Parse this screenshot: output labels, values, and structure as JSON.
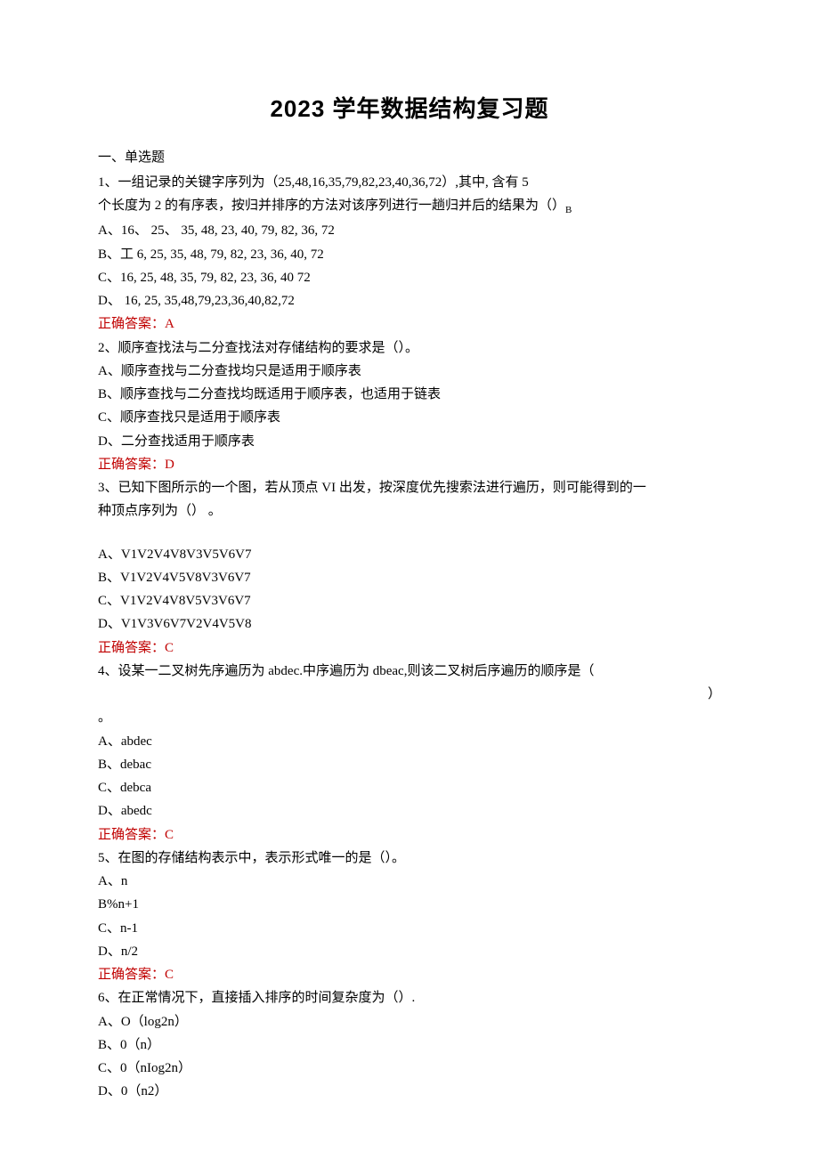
{
  "title": "2023 学年数据结构复习题",
  "section1": "一、单选题",
  "q1": {
    "stem_a": "1、一组记录的关键字序列为（25,48,16,35,79,82,23,40,36,72）,其中, 含有 5",
    "stem_b": "个长度为 2 的有序表，按归并排序的方法对该序列进行一趟归并后的结果为（）",
    "stem_sub": "B",
    "A": "A、16、 25、 35, 48, 23, 40, 79, 82, 36, 72",
    "B": "B、工 6, 25, 35, 48,        79, 82, 23, 36, 40, 72",
    "C": "C、16,    25, 48, 35, 79, 82, 23, 36, 40                         72",
    "D": "D、 16, 25, 35,48,79,23,36,40,82,72",
    "ans": "正确答案：A"
  },
  "q2": {
    "stem": "2、顺序查找法与二分查找法对存储结构的要求是（）。",
    "A": "A、顺序查找与二分查找均只是适用于顺序表",
    "B": "B、顺序查找与二分查找均既适用于顺序表，也适用于链表",
    "C": "C、顺序查找只是适用于顺序表",
    "D": "D、二分查找适用于顺序表",
    "ans": "正确答案：D"
  },
  "q3": {
    "stem_a": "3、已知下图所示的一个图，若从顶点 VI 出发，按深度优先搜索法进行遍历，则可能得到的一",
    "stem_b": "种顶点序列为（） 。",
    "A": "A、V1V2V4V8V3V5V6V7",
    "B": "B、V1V2V4V5V8V3V6V7",
    "C": "C、V1V2V4V8V5V3V6V7",
    "D": "D、V1V3V6V7V2V4V5V8",
    "ans": "正确答案：C"
  },
  "q4": {
    "stem": "4、设某一二叉树先序遍历为 abdec.中序遍历为 dbeac,则该二叉树后序遍历的顺序是（",
    "paren": "）",
    "dot": "。",
    "A": "A、abdec",
    "B": "B、debac",
    "C": "C、debca",
    "D": "D、abedc",
    "ans": "正确答案：C"
  },
  "q5": {
    "stem": "5、在图的存储结构表示中，表示形式唯一的是（）。",
    "A": "A、n",
    "B": "B%n+1",
    "C": "C、n-1",
    "D": "D、n/2",
    "ans": "正确答案：C"
  },
  "q6": {
    "stem": "6、在正常情况下，直接插入排序的时间复杂度为（）.",
    "A": "A、O（log2n）",
    "B": "B、0（n）",
    "C": "C、0（nIog2n）",
    "D": "D、0（n2）"
  }
}
